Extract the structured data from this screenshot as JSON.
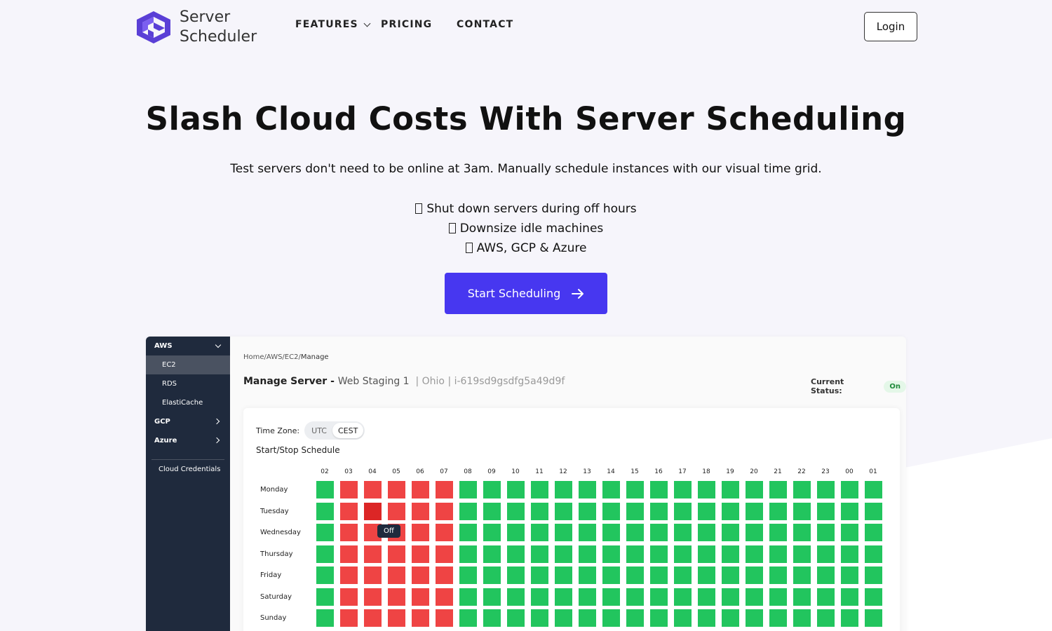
{
  "header": {
    "logo_line1": "Server",
    "logo_line2": "Scheduler",
    "nav": [
      {
        "label": "FEATURES"
      },
      {
        "label": "PRICING"
      },
      {
        "label": "CONTACT"
      }
    ],
    "login_label": "Login"
  },
  "hero": {
    "title": "Slash Cloud Costs With Server Scheduling",
    "subtitle": "Test servers don't need to be online at 3am. Manually schedule instances with our visual time grid.",
    "bullets": [
      "Shut down servers during off hours",
      "Downsize idle machines",
      "AWS, GCP & Azure"
    ],
    "cta_label": "Start Scheduling"
  },
  "colors": {
    "brand": "#4737f0",
    "on": "#22c55e",
    "off": "#ef4444",
    "off_hover": "#dc2626",
    "sidebar": "#1f2a3d"
  },
  "app": {
    "sidebar": {
      "aws": "AWS",
      "ec2": "EC2",
      "rds": "RDS",
      "elasticache": "ElastiCache",
      "gcp": "GCP",
      "azure": "Azure",
      "credentials": "Cloud Credentials"
    },
    "breadcrumb": {
      "path": "Home/AWS/EC2/",
      "current": "Manage"
    },
    "manage": {
      "label": "Manage Server - ",
      "server_name": "Web Staging 1",
      "meta": "| Ohio | i-619sd9gsdfg5a49d9f"
    },
    "status": {
      "label": "Current Status:",
      "value": "On"
    },
    "timezone": {
      "label": "Time Zone:",
      "options": [
        "UTC",
        "CEST"
      ],
      "selected": "CEST"
    },
    "schedule": {
      "title": "Start/Stop Schedule",
      "hours": [
        "02",
        "03",
        "04",
        "05",
        "06",
        "07",
        "08",
        "09",
        "10",
        "11",
        "12",
        "13",
        "14",
        "15",
        "16",
        "17",
        "18",
        "19",
        "20",
        "21",
        "22",
        "23",
        "00",
        "01"
      ],
      "days": [
        "Monday",
        "Tuesday",
        "Wednesday",
        "Thursday",
        "Friday",
        "Saturday",
        "Sunday"
      ],
      "off_hours": [
        "03",
        "04",
        "05",
        "06",
        "07"
      ],
      "hover_cell": {
        "day": "Tuesday",
        "hour": "04"
      },
      "tooltip": "Off"
    }
  }
}
